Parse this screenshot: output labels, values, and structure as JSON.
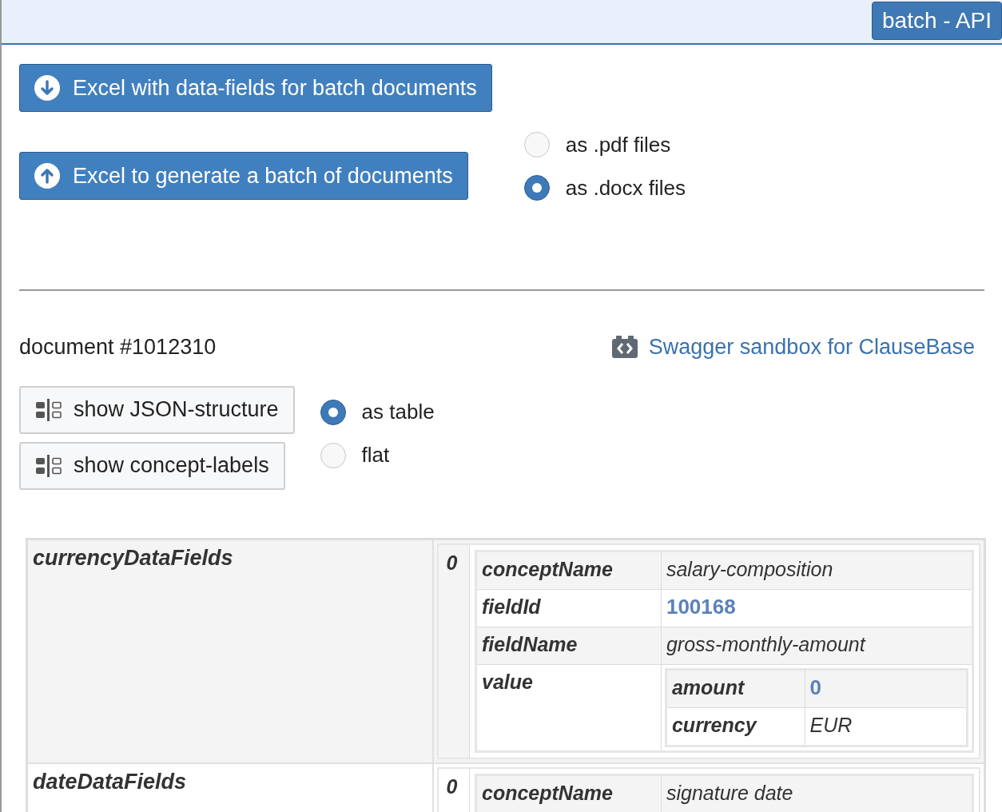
{
  "header": {
    "badge": "batch - API"
  },
  "batch": {
    "download_button": "Excel with data-fields for batch documents",
    "upload_button": "Excel to generate a batch of documents",
    "format_options": [
      {
        "label": "as .pdf files",
        "selected": false
      },
      {
        "label": "as .docx files",
        "selected": true
      }
    ]
  },
  "document": {
    "title": "document #1012310",
    "sandbox_link": "Swagger sandbox for ClauseBase",
    "view_buttons": [
      "show JSON-structure",
      "show concept-labels"
    ],
    "view_options": [
      {
        "label": "as table",
        "selected": true
      },
      {
        "label": "flat",
        "selected": false
      }
    ]
  },
  "data_table": [
    {
      "key": "currencyDataFields",
      "items": [
        {
          "index": "0",
          "fields": [
            {
              "kind": "text",
              "name": "conceptName",
              "value": "salary-composition"
            },
            {
              "kind": "number",
              "name": "fieldId",
              "value": "100168"
            },
            {
              "kind": "text",
              "name": "fieldName",
              "value": "gross-monthly-amount"
            },
            {
              "kind": "object",
              "name": "value",
              "fields": [
                {
                  "kind": "number",
                  "name": "amount",
                  "value": "0"
                },
                {
                  "kind": "text",
                  "name": "currency",
                  "value": "EUR"
                }
              ]
            }
          ]
        }
      ]
    },
    {
      "key": "dateDataFields",
      "items": [
        {
          "index": "0",
          "fields": [
            {
              "kind": "text",
              "name": "conceptName",
              "value": "signature date"
            }
          ]
        }
      ]
    }
  ]
}
